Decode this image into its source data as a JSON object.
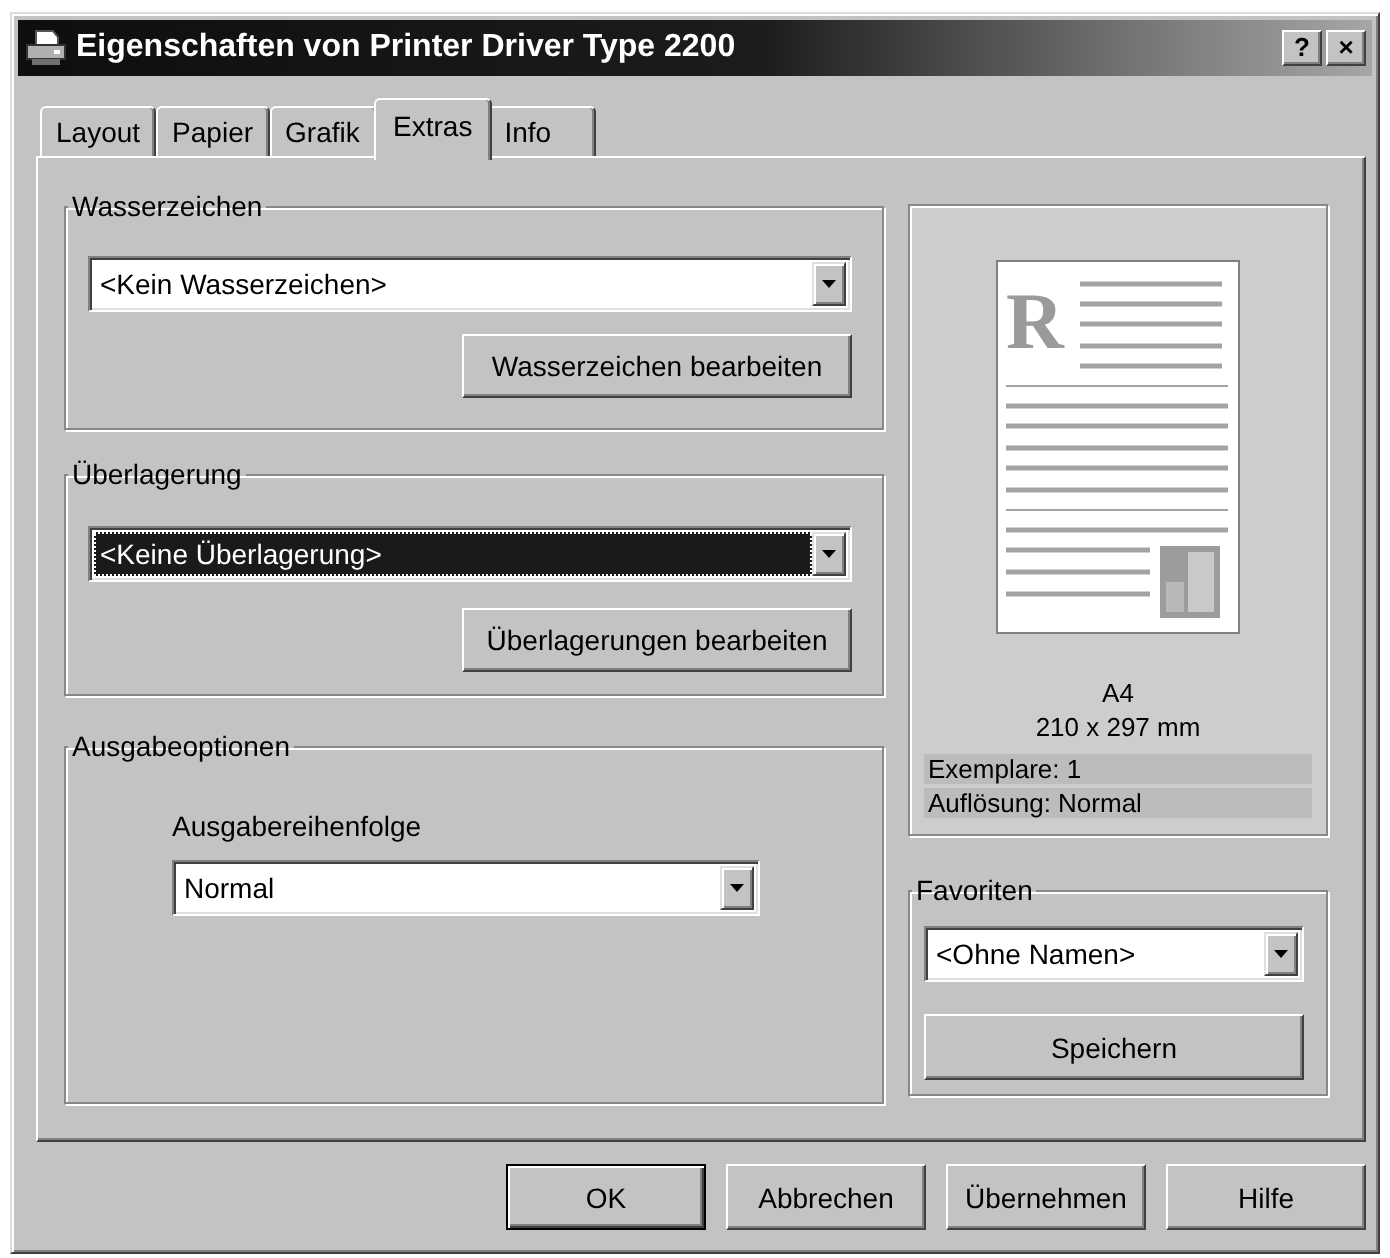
{
  "window": {
    "title": "Eigenschaften von Printer Driver Type 2200",
    "help_button": "?",
    "close_button": "×"
  },
  "tabs": [
    {
      "label": "Layout",
      "selected": false
    },
    {
      "label": "Papier",
      "selected": false
    },
    {
      "label": "Grafik",
      "selected": false
    },
    {
      "label": "Extras",
      "selected": true
    },
    {
      "label": "Info",
      "selected": false
    }
  ],
  "watermark": {
    "title": "Wasserzeichen",
    "dropdown": {
      "value": "<Kein Wasserzeichen>",
      "focused": false
    },
    "button": "Wasserzeichen bearbeiten"
  },
  "overlay": {
    "title": "Überlagerung",
    "dropdown": {
      "value": "<Keine Überlagerung>",
      "focused": true
    },
    "button": "Überlagerungen bearbeiten"
  },
  "output_options": {
    "title": "Ausgabeoptionen",
    "field_label": "Ausgabereihenfolge",
    "dropdown": {
      "value": "Normal",
      "focused": false
    }
  },
  "preview": {
    "sample_letter": "R",
    "paper_size": "A4",
    "dimensions": "210 x 297 mm",
    "details": [
      "Exemplare: 1",
      "Auflösung: Normal"
    ]
  },
  "favorites": {
    "title": "Favoriten",
    "dropdown": {
      "value": "<Ohne Namen>",
      "focused": false
    },
    "button": "Speichern"
  },
  "dialog_buttons": [
    {
      "label": "OK",
      "default": true
    },
    {
      "label": "Abbrechen",
      "default": false
    },
    {
      "label": "Übernehmen",
      "default": false
    },
    {
      "label": "Hilfe",
      "default": false
    }
  ]
}
